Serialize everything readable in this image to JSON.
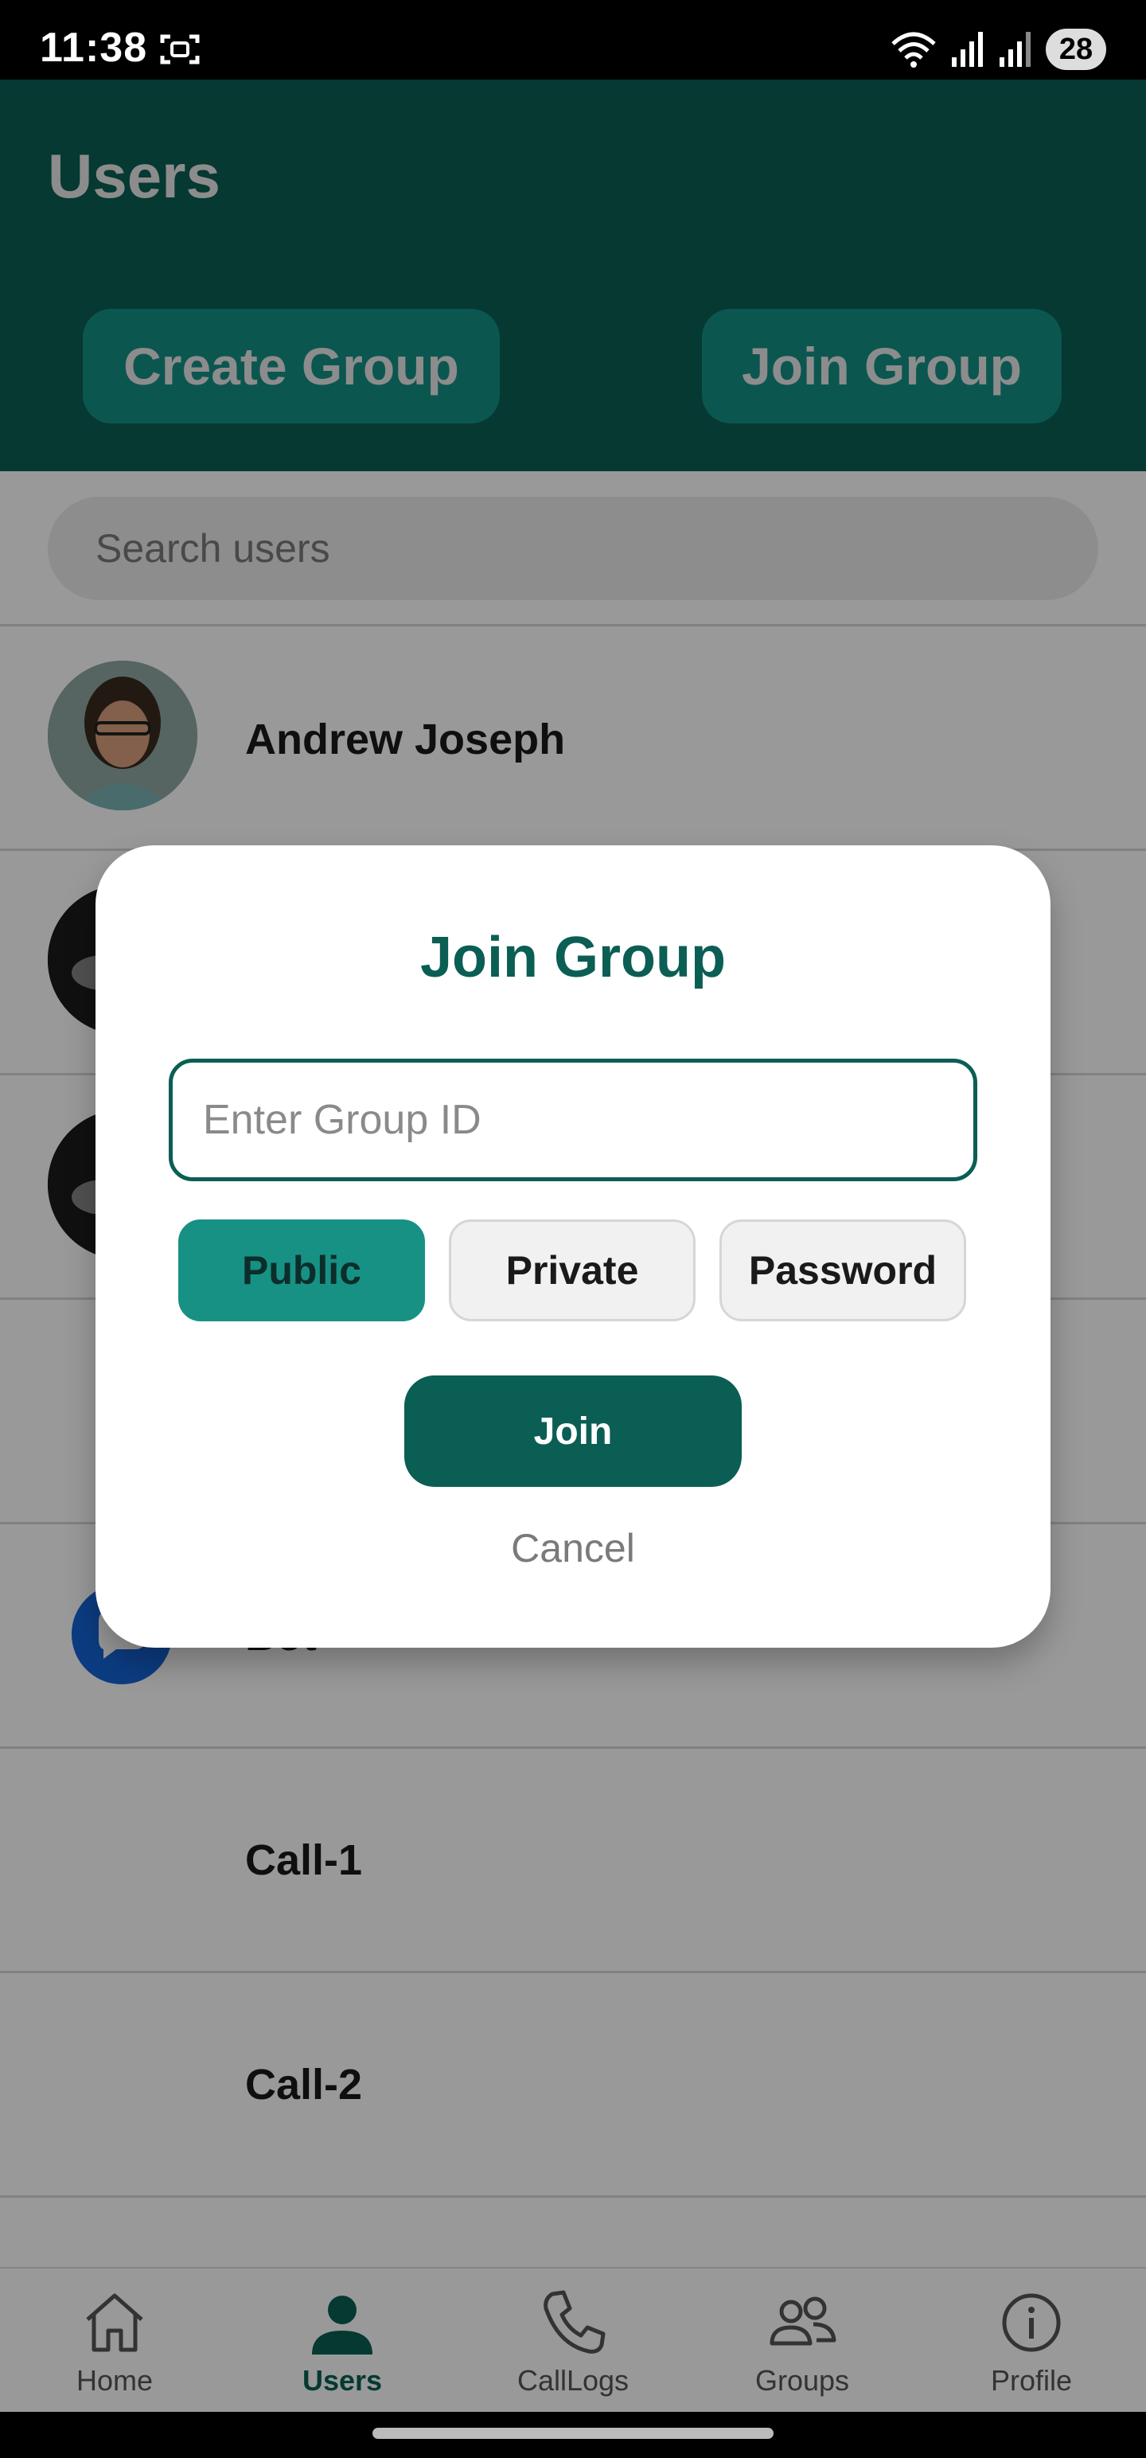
{
  "status_bar": {
    "time": "11:38",
    "battery": "28"
  },
  "header": {
    "title": "Users",
    "create_group_label": "Create Group",
    "join_group_label": "Join Group"
  },
  "search": {
    "placeholder": "Search users"
  },
  "users": [
    {
      "name": "Andrew Joseph"
    },
    {
      "name": ""
    },
    {
      "name": ""
    },
    {
      "name": ""
    },
    {
      "name": "Bot"
    },
    {
      "name": "Call-1"
    },
    {
      "name": "Call-2"
    }
  ],
  "dialog": {
    "title": "Join Group",
    "input_placeholder": "Enter Group ID",
    "types": [
      "Public",
      "Private",
      "Password"
    ],
    "selected_type": "Public",
    "join_label": "Join",
    "cancel_label": "Cancel"
  },
  "nav": [
    {
      "label": "Home",
      "icon": "home-icon"
    },
    {
      "label": "Users",
      "icon": "user-icon",
      "active": true
    },
    {
      "label": "CallLogs",
      "icon": "phone-icon"
    },
    {
      "label": "Groups",
      "icon": "groups-icon"
    },
    {
      "label": "Profile",
      "icon": "info-icon"
    }
  ],
  "colors": {
    "primary": "#095f54",
    "accent": "#179184"
  }
}
